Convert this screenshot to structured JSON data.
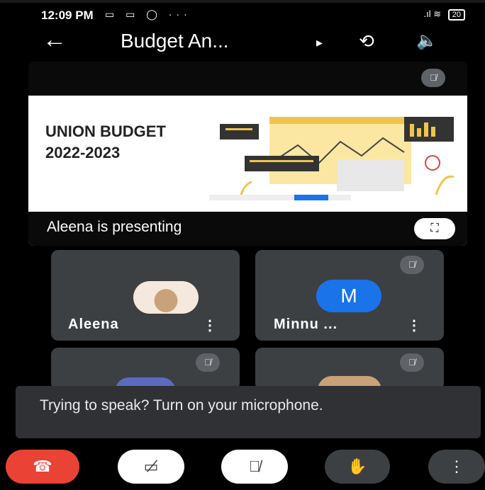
{
  "status_bar": {
    "time": "12:09 PM",
    "left_icons": "▭ ▭ ◯ ···",
    "signal": ".ıl",
    "wifi": "≋",
    "battery": "20"
  },
  "top_bar": {
    "back_icon": "←",
    "meeting_title": "Budget An...",
    "title_caret": "▸",
    "switch_camera_icon": "⟲",
    "speaker_icon": "🔈"
  },
  "presentation": {
    "slide_title_line1": "UNION BUDGET",
    "slide_title_line2": "2022-2023",
    "presenting_label": "Aleena is presenting",
    "fullscreen_icon": "⛶",
    "muted_icon": "🎙̸"
  },
  "participants": [
    {
      "name": "Aleena",
      "menu": "⋮",
      "avatar": "photo"
    },
    {
      "name": "Minnu ...",
      "menu": "⋮",
      "avatar_letter": "M",
      "muted": true
    },
    {
      "name": "",
      "muted": true
    },
    {
      "name": "",
      "muted": true
    }
  ],
  "toast": {
    "text": "Trying to speak? Turn on your microphone."
  },
  "controls": {
    "hangup_icon": "☎",
    "camera_off_icon": "▭̸",
    "mic_off_icon": "🎙̸",
    "raise_hand_icon": "✋",
    "more_icon": "⋮"
  },
  "colors": {
    "hangup": "#ea4335",
    "avatar_m": "#1a73e8",
    "tile_bg": "#3c4043"
  }
}
